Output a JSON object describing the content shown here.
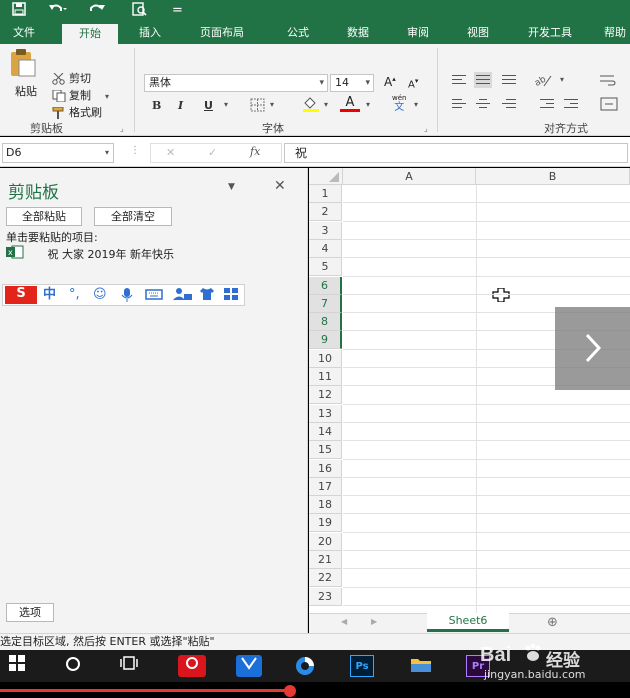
{
  "quick_access": {
    "save_icon": "save-icon",
    "undo_icon": "undo-icon",
    "redo_icon": "redo-icon",
    "preview_icon": "print-preview-icon",
    "customize": "="
  },
  "tabs": [
    "文件",
    "开始",
    "插入",
    "页面布局",
    "公式",
    "数据",
    "审阅",
    "视图",
    "开发工具",
    "帮助"
  ],
  "active_tab": "开始",
  "ribbon": {
    "clipboard": {
      "paste": "粘贴",
      "cut": "剪切",
      "copy": "复制",
      "format_painter": "格式刷",
      "label": "剪贴板"
    },
    "font": {
      "name": "黑体",
      "size": "14",
      "grow": "A",
      "shrink": "A",
      "bold": "B",
      "italic": "I",
      "underline": "U",
      "font_color_letter": "A",
      "phonetic": "wén",
      "phonetic2": "文",
      "label": "字体"
    },
    "alignment": {
      "label": "对齐方式"
    }
  },
  "formula_bar": {
    "name_box": "D6",
    "cancel": "✕",
    "enter": "✓",
    "fx": "fx",
    "content": "祝"
  },
  "clipboard_pane": {
    "title": "剪贴板",
    "paste_all": "全部粘贴",
    "clear_all": "全部清空",
    "hint": "单击要粘贴的项目:",
    "items": [
      "祝 大家 2019年 新年快乐"
    ],
    "options": "选项"
  },
  "ime_toolbar": {
    "logo": "S",
    "lang": "中",
    "punct": "°,",
    "emoji": "☺",
    "mic": "🎤",
    "keyboard": "⌨",
    "user": "👤",
    "skin": "👕",
    "menu": "▦"
  },
  "grid": {
    "columns": [
      "A",
      "B"
    ],
    "rows": [
      "1",
      "2",
      "3",
      "4",
      "5",
      "6",
      "7",
      "8",
      "9",
      "10",
      "11",
      "12",
      "13",
      "14",
      "15",
      "16",
      "17",
      "18",
      "19",
      "20",
      "21",
      "22",
      "23"
    ],
    "selected_rows": [
      "6",
      "7",
      "8",
      "9"
    ]
  },
  "sheet_tabs": {
    "active": "Sheet6",
    "add": "⊕",
    "prev": "◀",
    "next": "▶"
  },
  "status_bar": {
    "text": "选定目标区域, 然后按 ENTER 或选择\"粘贴\""
  },
  "watermark": {
    "brand": "Bai",
    "brand2": "经验",
    "site": "jingyan.baidu.com"
  },
  "colors": {
    "accent": "#217346",
    "ribbon_bg": "#f3f3f3",
    "progress": "#e53935"
  },
  "video": {
    "progress": 0.46
  }
}
